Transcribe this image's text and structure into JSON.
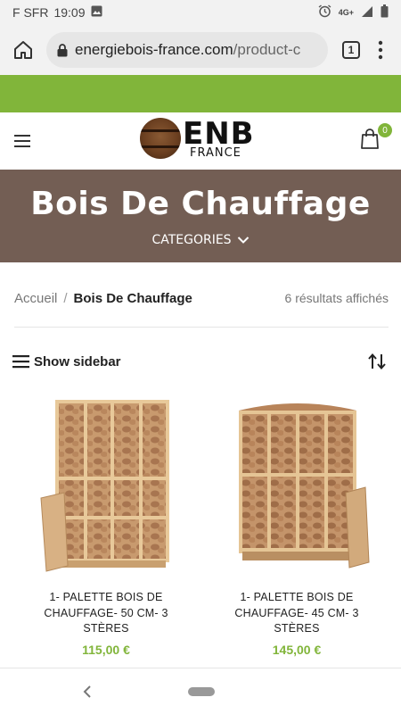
{
  "status_bar": {
    "carrier": "F SFR",
    "time": "19:09",
    "network": "4G+"
  },
  "browser": {
    "url_host": "energiebois-france.com",
    "url_path": "/product-c",
    "tab_count": "1"
  },
  "site": {
    "logo_main": "ENB",
    "logo_sub": "FRANCE",
    "cart_count": "0"
  },
  "hero": {
    "title": "Bois De Chauffage",
    "categories_label": "CATEGORIES"
  },
  "breadcrumb": {
    "home": "Accueil",
    "separator": "/",
    "current": "Bois De Chauffage",
    "results": "6 résultats affichés"
  },
  "toolbar": {
    "sidebar_label": "Show sidebar"
  },
  "products": [
    {
      "name": "1- PALETTE BOIS DE CHAUFFAGE- 50 CM- 3 STÈRES",
      "price": "115,00 €"
    },
    {
      "name": "1- PALETTE BOIS DE CHAUFFAGE- 45 CM- 3 STÈRES",
      "price": "145,00 €"
    }
  ],
  "colors": {
    "accent_green": "#81b53a",
    "hero_brown": "#735e54"
  }
}
